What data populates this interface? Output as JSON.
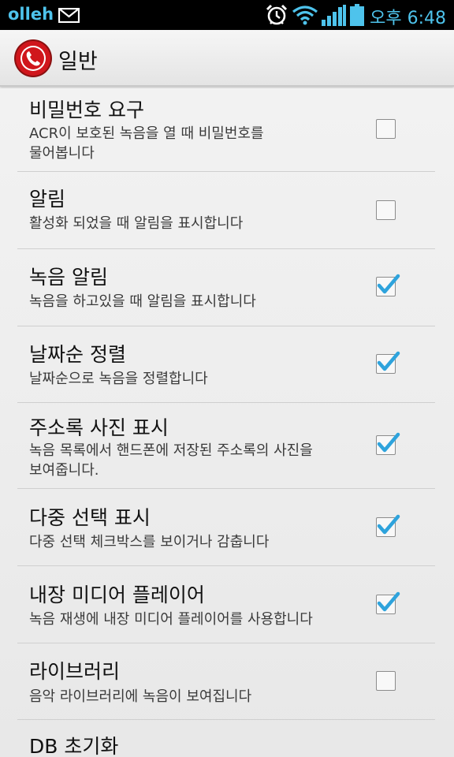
{
  "status_bar": {
    "carrier": "olleh",
    "time": "오후 6:48",
    "icons": [
      "mail-icon",
      "alarm-icon",
      "wifi-icon",
      "signal-icon",
      "battery-icon"
    ],
    "accent": "#4ec3ec"
  },
  "action_bar": {
    "title": "일반",
    "app_icon": "phone-record-icon",
    "icon_color": "#d0161c"
  },
  "settings": [
    {
      "title": "비밀번호 요구",
      "summary": "ACR이 보호된 녹음을 열 때 비밀번호를\n물어봅니다",
      "checked": false
    },
    {
      "title": "알림",
      "summary": "활성화 되었을 때 알림을 표시합니다",
      "checked": false
    },
    {
      "title": "녹음 알림",
      "summary": "녹음을 하고있을 때 알림을 표시합니다",
      "checked": true
    },
    {
      "title": "날짜순 정렬",
      "summary": "날짜순으로 녹음을 정렬합니다",
      "checked": true
    },
    {
      "title": "주소록 사진 표시",
      "summary": "녹음 목록에서 핸드폰에 저장된 주소록의 사진을\n보여줍니다.",
      "checked": true
    },
    {
      "title": "다중 선택 표시",
      "summary": "다중 선택 체크박스를 보이거나 감춥니다",
      "checked": true
    },
    {
      "title": "내장 미디어 플레이어",
      "summary": "녹음 재생에 내장 미디어 플레이어를 사용합니다",
      "checked": true
    },
    {
      "title": "라이브러리",
      "summary": "음악 라이브러리에 녹음이 보여집니다",
      "checked": false
    },
    {
      "title": "DB 초기화"
    }
  ],
  "colors": {
    "checkmark": "#2ea3dc"
  }
}
